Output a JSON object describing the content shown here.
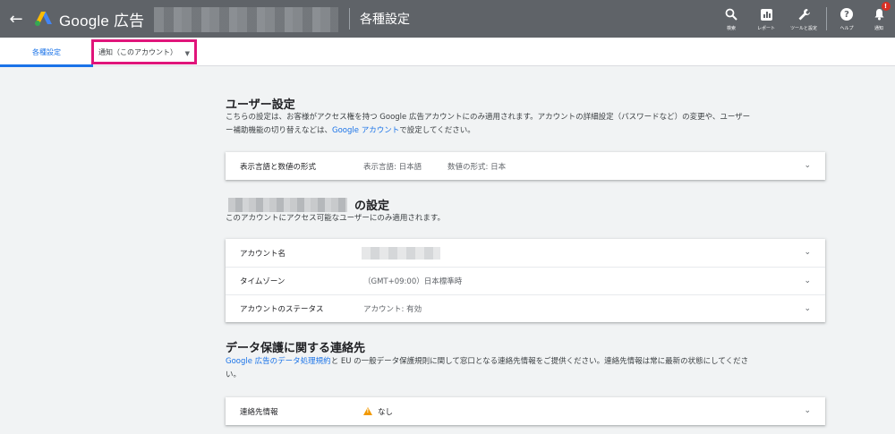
{
  "header": {
    "back_icon": "arrow-back-icon",
    "brand": "Google 広告",
    "page_title": "各種設定",
    "tools": [
      {
        "icon": "search-icon",
        "label": "検索"
      },
      {
        "icon": "report-icon",
        "label": "レポート"
      },
      {
        "icon": "wrench-icon",
        "label": "ツールと設定"
      },
      {
        "icon": "help-icon",
        "label": "ヘルプ"
      },
      {
        "icon": "bell-icon",
        "label": "通知",
        "badge": "!"
      }
    ]
  },
  "tabs": {
    "active": "各種設定",
    "dropdown_value": "通知（このアカウント）",
    "accent": "#1a73e8",
    "highlight": "#e0147a"
  },
  "user_settings": {
    "title": "ユーザー設定",
    "desc_part1": "こちらの設定は、お客様がアクセス権を持つ Google 広告アカウントにのみ適用されます。アカウントの詳細設定（パスワードなど）の変更や、ユーザー",
    "desc_part2": "ー補助機能の切り替えなどは、",
    "desc_link": "Google アカウント",
    "desc_part3": "で設定してください。",
    "row": {
      "label": "表示言語と数値の形式",
      "value1": "表示言語: 日本語",
      "value2": "数値の形式: 日本"
    }
  },
  "account_settings": {
    "title_suffix": "の設定",
    "desc": "このアカウントにアクセス可能なユーザーにのみ適用されます。",
    "rows": [
      {
        "label": "アカウント名",
        "value": ""
      },
      {
        "label": "タイムゾーン",
        "value": "（GMT+09:00）日本標準時"
      },
      {
        "label": "アカウントのステータス",
        "value": "アカウント: 有効"
      }
    ]
  },
  "data_protection": {
    "title": "データ保護に関する連絡先",
    "desc_link": "Google 広告のデータ処理規約",
    "desc_part1": "と EU の一般データ保護規則に関して窓口となる連絡先情報をご提供ください。連絡先情報は常に最新の状態にしてくださ",
    "desc_part2": "い。",
    "row": {
      "label": "連絡先情報",
      "value": "なし",
      "icon": "warning-icon",
      "icon_color": "#f29900"
    }
  }
}
